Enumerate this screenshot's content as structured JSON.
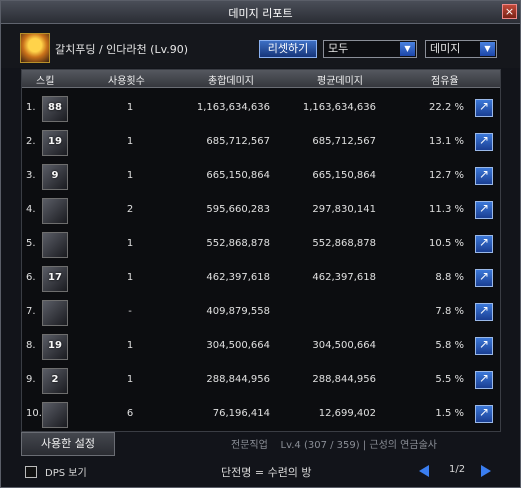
{
  "window": {
    "title": "데미지 리포트",
    "close_icon": "close-icon"
  },
  "header": {
    "character": "갈치푸딩 / 인다라천 (Lv.90)",
    "reset_label": "리셋하기",
    "filter_selected": "모두",
    "sort_selected": "데미지"
  },
  "columns": {
    "skill": "스킬",
    "count": "사용횟수",
    "total": "총합데미지",
    "avg": "평균데미지",
    "share": "점유율"
  },
  "rows": [
    {
      "rank": "1.",
      "level": "88",
      "count": "1",
      "total": "1,163,634,636",
      "avg": "1,163,634,636",
      "share": "22.2 %"
    },
    {
      "rank": "2.",
      "level": "19",
      "count": "1",
      "total": "685,712,567",
      "avg": "685,712,567",
      "share": "13.1 %"
    },
    {
      "rank": "3.",
      "level": "9",
      "count": "1",
      "total": "665,150,864",
      "avg": "665,150,864",
      "share": "12.7 %"
    },
    {
      "rank": "4.",
      "level": "",
      "count": "2",
      "total": "595,660,283",
      "avg": "297,830,141",
      "share": "11.3 %"
    },
    {
      "rank": "5.",
      "level": "",
      "count": "1",
      "total": "552,868,878",
      "avg": "552,868,878",
      "share": "10.5 %"
    },
    {
      "rank": "6.",
      "level": "17",
      "count": "1",
      "total": "462,397,618",
      "avg": "462,397,618",
      "share": "8.8 %"
    },
    {
      "rank": "7.",
      "level": "",
      "count": "-",
      "total": "409,879,558",
      "avg": "",
      "share": "7.8 %"
    },
    {
      "rank": "8.",
      "level": "19",
      "count": "1",
      "total": "304,500,664",
      "avg": "304,500,664",
      "share": "5.8 %"
    },
    {
      "rank": "9.",
      "level": "2",
      "count": "1",
      "total": "288,844,956",
      "avg": "288,844,956",
      "share": "5.5 %"
    },
    {
      "rank": "10.",
      "level": "",
      "count": "6",
      "total": "76,196,414",
      "avg": "12,699,402",
      "share": "1.5 %"
    }
  ],
  "footer": {
    "settings_label": "사용한 설정",
    "dps_label": "DPS 보기",
    "page": "1/2",
    "bg_job": "전문직업",
    "bg_job_value": "Lv.4 (307 / 359) | 근성의 연금술사",
    "bg_guild": "단전명 = 수련의 방"
  },
  "colors": {
    "accent": "#2a62c8",
    "frame": "#5a5e68",
    "row_bg": "#0c0d10"
  }
}
